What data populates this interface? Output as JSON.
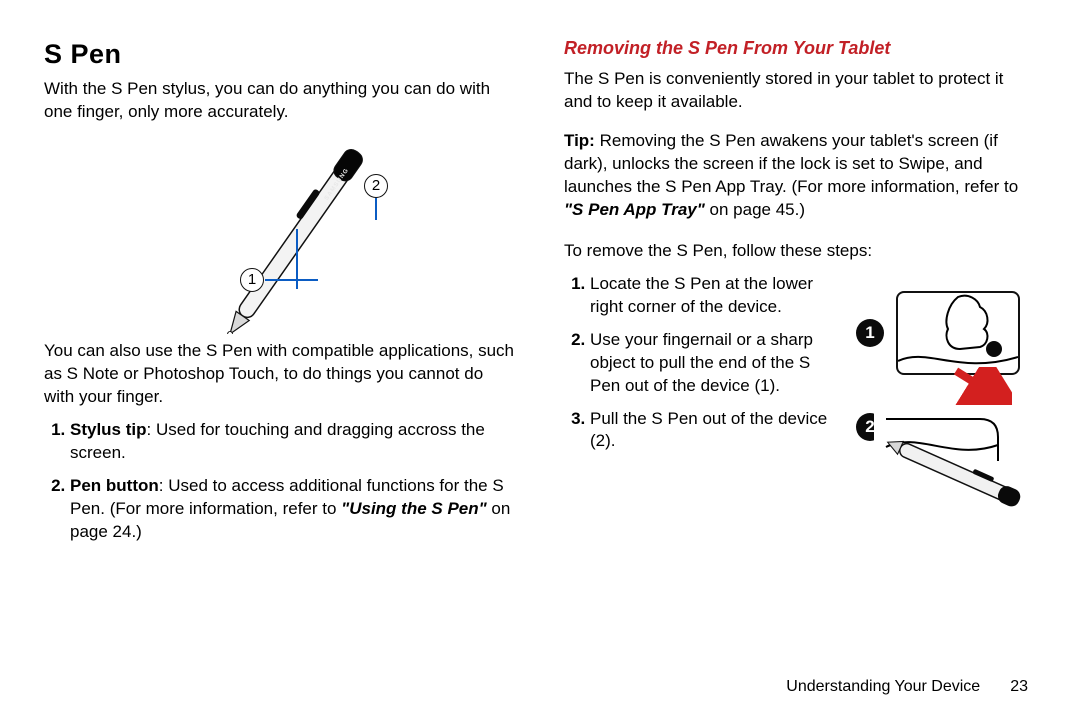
{
  "left": {
    "title": "S Pen",
    "intro": "With the S Pen stylus, you can do anything you can do with one finger, only more accurately.",
    "figure": {
      "callout1": "1",
      "callout2": "2",
      "pen_brand": "SAMSUNG"
    },
    "para2": "You can also use the S Pen with compatible applications, such as S Note or Photoshop Touch, to do things you cannot do with your finger.",
    "items": [
      {
        "label": "Stylus tip",
        "text": ": Used for touching and dragging accross the screen."
      },
      {
        "label": "Pen button",
        "text_lead": ": Used to access additional functions for the S Pen. (For more information, refer to ",
        "xref": "\"Using the S Pen\"",
        "text_tail": " on page 24.)"
      }
    ]
  },
  "right": {
    "heading": "Removing the S Pen From Your Tablet",
    "intro": "The S Pen is conveniently stored in your tablet to protect it and to keep it available.",
    "tip_label": "Tip:",
    "tip_lead": " Removing the S Pen awakens your tablet's screen (if dark), unlocks the screen if the lock is set to Swipe, and launches the S Pen App Tray. (For more information, refer to ",
    "tip_xref": "\"S Pen App Tray\"",
    "tip_tail": " on page 45.)",
    "steps_intro": "To remove the S Pen, follow these steps:",
    "steps": [
      "Locate the S Pen at the lower right corner of the device.",
      "Use your fingernail or a sharp object to pull the end of the S Pen out of the device (1).",
      "Pull the S Pen out of the device (2)."
    ],
    "figure": {
      "num1": "1",
      "num2": "2"
    }
  },
  "footer": {
    "section": "Understanding Your Device",
    "page": "23"
  }
}
